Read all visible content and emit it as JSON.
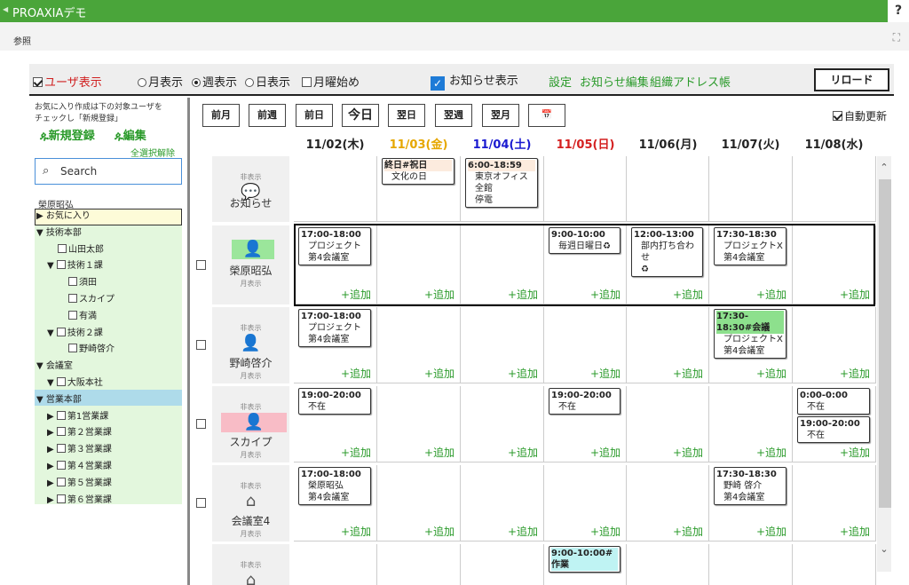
{
  "app": {
    "title": "PROAXIAデモ",
    "help": "?"
  },
  "menu": {
    "ref": "参照",
    "expand_icon": "expand-icon"
  },
  "toolbar": {
    "user_view": "ユーザ表示",
    "month_view": "月表示",
    "week_view": "週表示",
    "day_view": "日表示",
    "monday_start": "月曜始め",
    "notice_view": "お知らせ表示",
    "settings": "設定",
    "notice_edit": "お知らせ編集",
    "org_address": "組織アドレス帳",
    "reload": "リロード"
  },
  "sidebar": {
    "note": "お気に入り作成は下の対象ユーザを\nチェックし「新規登録」",
    "new_register": "新規登録",
    "edit": "編集",
    "clear_all": "全選択解除",
    "search_placeholder": "Search",
    "user_name": "榮原昭弘",
    "tree": [
      {
        "label": "お気に入り",
        "indent": 0,
        "toggle": "▶",
        "checkbox": false,
        "highlight": "favorite"
      },
      {
        "label": "技術本部",
        "indent": 0,
        "toggle": "▼",
        "checkbox": false
      },
      {
        "label": "山田太郎",
        "indent": 2,
        "toggle": "",
        "checkbox": true
      },
      {
        "label": "技術１課",
        "indent": 1,
        "toggle": "▼",
        "checkbox": true
      },
      {
        "label": "須田",
        "indent": 3,
        "toggle": "",
        "checkbox": true
      },
      {
        "label": "スカイプ",
        "indent": 3,
        "toggle": "",
        "checkbox": true
      },
      {
        "label": "有満",
        "indent": 3,
        "toggle": "",
        "checkbox": true
      },
      {
        "label": "技術２課",
        "indent": 1,
        "toggle": "▼",
        "checkbox": true
      },
      {
        "label": "野崎啓介",
        "indent": 3,
        "toggle": "",
        "checkbox": true
      },
      {
        "label": "会議室",
        "indent": 0,
        "toggle": "▼",
        "checkbox": false
      },
      {
        "label": "大阪本社",
        "indent": 1,
        "toggle": "▼",
        "checkbox": true
      },
      {
        "label": "営業本部",
        "indent": 0,
        "toggle": "▼",
        "checkbox": false,
        "highlight": "selected"
      },
      {
        "label": "第1営業課",
        "indent": 1,
        "toggle": "▶",
        "checkbox": true
      },
      {
        "label": "第２営業課",
        "indent": 1,
        "toggle": "▶",
        "checkbox": true
      },
      {
        "label": "第３営業課",
        "indent": 1,
        "toggle": "▶",
        "checkbox": true
      },
      {
        "label": "第４営業課",
        "indent": 1,
        "toggle": "▶",
        "checkbox": true
      },
      {
        "label": "第５営業課",
        "indent": 1,
        "toggle": "▶",
        "checkbox": true
      },
      {
        "label": "第６営業課",
        "indent": 1,
        "toggle": "▶",
        "checkbox": true
      }
    ]
  },
  "nav": {
    "prev_month": "前月",
    "prev_week": "前週",
    "prev_day": "前日",
    "today": "今日",
    "next_day": "翌日",
    "next_week": "翌週",
    "next_month": "翌月",
    "calendar_icon": "calendar-icon",
    "auto_update": "自動更新"
  },
  "days": [
    {
      "label": "11/02(木)",
      "color": "#222222"
    },
    {
      "label": "11/03(金)",
      "color": "#e6a700"
    },
    {
      "label": "11/04(土)",
      "color": "#1a1ad0"
    },
    {
      "label": "11/05(日)",
      "color": "#d42020"
    },
    {
      "label": "11/06(月)",
      "color": "#222222"
    },
    {
      "label": "11/07(火)",
      "color": "#222222"
    },
    {
      "label": "11/08(水)",
      "color": "#222222"
    }
  ],
  "add_label": "+追加",
  "rows": [
    {
      "hidden_label": "非表示",
      "name": "お知らせ",
      "sub": "",
      "icon": "notice-icon",
      "checkbox": false,
      "add": false,
      "events": [
        {
          "day": 1,
          "time": "終日#祝日",
          "lines": [
            "文化の日"
          ],
          "style": "pink"
        },
        {
          "day": 2,
          "time": "6:00-18:59",
          "lines": [
            "東京オフィス全館",
            "停電"
          ],
          "style": "pink"
        }
      ]
    },
    {
      "hidden_label": "",
      "name": "榮原昭弘",
      "sub": "月表示",
      "icon": "user-photo",
      "checkbox": true,
      "add": true,
      "events": [
        {
          "day": 0,
          "time": "17:00-18:00",
          "lines": [
            "プロジェクト",
            "第4会議室"
          ],
          "style": "plain"
        },
        {
          "day": 3,
          "time": "9:00-10:00",
          "lines": [
            "毎週日曜日♻"
          ],
          "style": "plain"
        },
        {
          "day": 4,
          "time": "12:00-13:00",
          "lines": [
            "部内打ち合わせ",
            "♻"
          ],
          "style": "plain"
        },
        {
          "day": 5,
          "time": "17:30-18:30",
          "lines": [
            "プロジェクトX",
            "第4会議室"
          ],
          "style": "plain"
        }
      ]
    },
    {
      "hidden_label": "非表示",
      "name": "野崎啓介",
      "sub": "月表示",
      "icon": "user-photo-2",
      "checkbox": true,
      "add": true,
      "events": [
        {
          "day": 0,
          "time": "17:00-18:00",
          "lines": [
            "プロジェクト",
            "第4会議室"
          ],
          "style": "plain"
        },
        {
          "day": 5,
          "time": "17:30-18:30#会議",
          "lines": [
            "プロジェクトX",
            "第4会議室"
          ],
          "style": "green"
        }
      ]
    },
    {
      "hidden_label": "非表示",
      "name": "スカイプ",
      "sub": "月表示",
      "icon": "person-icon",
      "checkbox": true,
      "add": true,
      "events": [
        {
          "day": 0,
          "time": "19:00-20:00",
          "lines": [
            "不在"
          ],
          "style": "plain"
        },
        {
          "day": 3,
          "time": "19:00-20:00",
          "lines": [
            "不在"
          ],
          "style": "plain"
        },
        {
          "day": 6,
          "time": "0:00-0:00",
          "lines": [
            "不在"
          ],
          "style": "plain"
        },
        {
          "day": 6,
          "time": "19:00-20:00",
          "lines": [
            "不在"
          ],
          "style": "plain",
          "slot": 1
        }
      ]
    },
    {
      "hidden_label": "非表示",
      "name": "会議室4",
      "sub": "月表示",
      "icon": "home-icon",
      "checkbox": true,
      "add": true,
      "events": [
        {
          "day": 0,
          "time": "17:00-18:00",
          "lines": [
            "榮原昭弘",
            "第4会議室"
          ],
          "style": "plain"
        },
        {
          "day": 5,
          "time": "17:30-18:30",
          "lines": [
            "野崎 啓介",
            "第4会議室"
          ],
          "style": "plain"
        }
      ]
    },
    {
      "hidden_label": "非表示",
      "name": "",
      "sub": "",
      "icon": "home-icon",
      "checkbox": false,
      "add": false,
      "events": [
        {
          "day": 3,
          "time": "9:00-10:00#作業",
          "lines": [],
          "style": "cyan"
        }
      ]
    }
  ]
}
